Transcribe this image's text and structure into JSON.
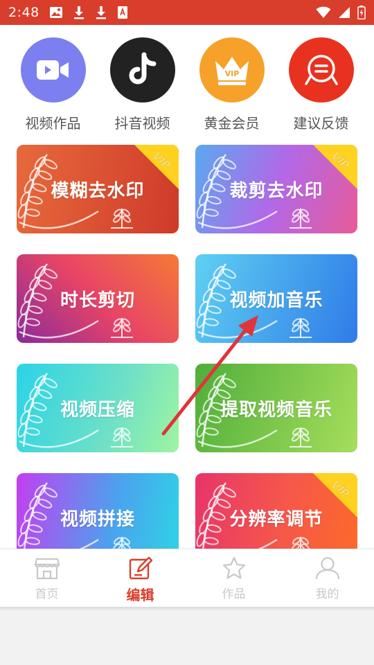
{
  "status_bar": {
    "time": "2:48",
    "notification_icons": [
      "image-icon",
      "download-icon",
      "download-icon",
      "text-file-icon"
    ],
    "system_icons": [
      "wifi-icon",
      "signal-icon",
      "battery-icon"
    ],
    "color": "#d93d2b"
  },
  "quick_actions": [
    {
      "label": "视频作品",
      "icon": "video-camera-icon",
      "color": "#7b7ff0"
    },
    {
      "label": "抖音视频",
      "icon": "tiktok-icon",
      "color": "#222222"
    },
    {
      "label": "黄金会员",
      "icon": "vip-crown-icon",
      "color": "#f6a12a"
    },
    {
      "label": "建议反馈",
      "icon": "feedback-icon",
      "color": "#e8321f"
    }
  ],
  "features": [
    {
      "label": "模糊去水印",
      "vip": true,
      "vip_text": "VIP"
    },
    {
      "label": "裁剪去水印",
      "vip": true,
      "vip_text": "VIP"
    },
    {
      "label": "时长剪切",
      "vip": false
    },
    {
      "label": "视频加音乐",
      "vip": false
    },
    {
      "label": "视频压缩",
      "vip": false
    },
    {
      "label": "提取视频音乐",
      "vip": false
    },
    {
      "label": "视频拼接",
      "vip": false
    },
    {
      "label": "分辨率调节",
      "vip": true,
      "vip_text": "VIP"
    }
  ],
  "bottom_nav": {
    "active_index": 1,
    "active_color": "#d93d2b",
    "items": [
      {
        "label": "首页",
        "icon": "shop-icon"
      },
      {
        "label": "编辑",
        "icon": "edit-icon"
      },
      {
        "label": "作品",
        "icon": "star-icon"
      },
      {
        "label": "我的",
        "icon": "person-icon"
      }
    ]
  }
}
